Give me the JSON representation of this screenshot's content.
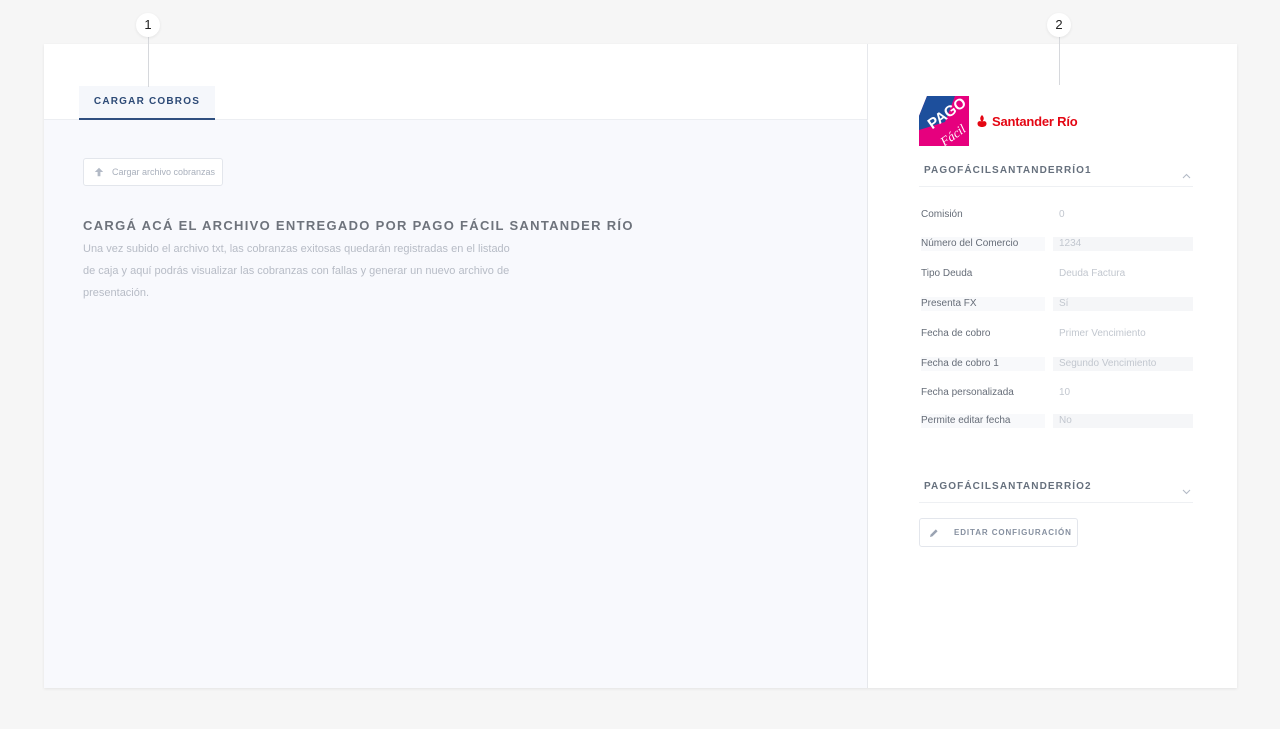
{
  "callouts": [
    "1",
    "2"
  ],
  "tabs": [
    {
      "label": "CARGAR COBROS",
      "active": true
    }
  ],
  "upload": {
    "label": "Cargar archivo cobranzas",
    "icon": "upload-arrow-icon"
  },
  "main": {
    "title": "CARGÁ ACÁ EL ARCHIVO ENTREGADO POR PAGO FÁCIL SANTANDER RÍO",
    "description": "Una vez subido el archivo txt, las cobranzas exitosas quedarán registradas en el listado de caja y aquí podrás visualizar las cobranzas con fallas y generar un nuevo archivo de presentación."
  },
  "logo": {
    "badge_top": "PAGO",
    "badge_bottom": "Fácil",
    "brand": "Santander Río",
    "badge_color": "#e6007e",
    "brand_color": "#e40613"
  },
  "sections": [
    {
      "title": "PAGOFÁCILSANTANDERRÍO1",
      "expanded": true,
      "icon": "chevron-up-icon"
    },
    {
      "title": "PAGOFÁCILSANTANDERRÍO2",
      "expanded": false,
      "icon": "chevron-down-icon"
    }
  ],
  "fields": [
    {
      "label": "Comisión",
      "value": "0"
    },
    {
      "label": "Número del Comercio",
      "value": "1234"
    },
    {
      "label": "Tipo Deuda",
      "value": "Deuda Factura"
    },
    {
      "label": "Presenta FX",
      "value": "Sí"
    },
    {
      "label": "Fecha de cobro",
      "value": "Primer Vencimiento"
    },
    {
      "label": "Fecha de cobro 1",
      "value": "Segundo Vencimiento"
    },
    {
      "label": "Fecha personalizada",
      "value": "10"
    },
    {
      "label": "Permite editar fecha",
      "value": "No"
    }
  ],
  "edit_button": {
    "label": "EDITAR CONFIGURACIÓN",
    "icon": "pencil-icon"
  },
  "colors": {
    "accent": "#2d4a76",
    "content_bg": "#f8f9fd",
    "page_bg": "#f6f6f6"
  }
}
